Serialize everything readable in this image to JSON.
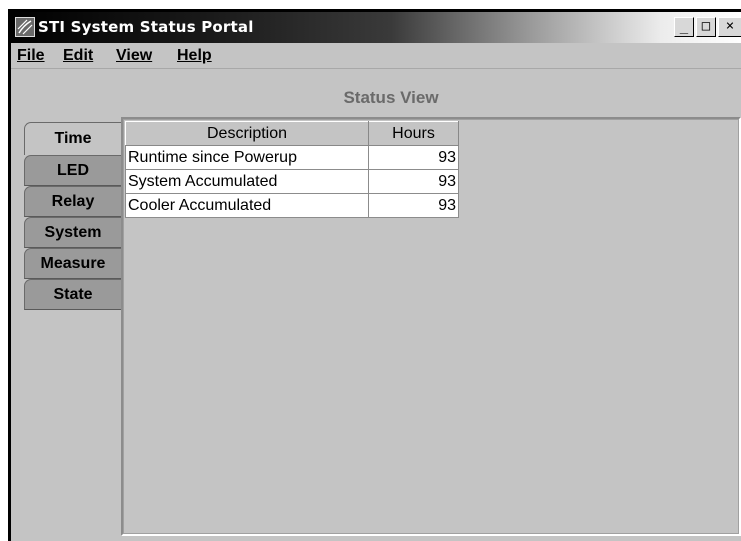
{
  "window": {
    "title": "STI System Status Portal",
    "minimize_glyph": "_",
    "maximize_glyph": "□",
    "close_glyph": "×"
  },
  "menu": [
    {
      "label": "File"
    },
    {
      "label": "Edit"
    },
    {
      "label": "View"
    },
    {
      "label": "Help"
    }
  ],
  "view_title": "Status View",
  "tabs": [
    {
      "label": "Time",
      "active": true
    },
    {
      "label": "LED"
    },
    {
      "label": "Relay"
    },
    {
      "label": "System"
    },
    {
      "label": "Measure"
    },
    {
      "label": "State"
    }
  ],
  "table": {
    "headers": [
      "Description",
      "Hours"
    ],
    "rows": [
      [
        "Runtime since Powerup",
        "93"
      ],
      [
        "System Accumulated",
        "93"
      ],
      [
        "Cooler Accumulated",
        "93"
      ]
    ]
  },
  "colors": {
    "window_bg": "#c4c4c4",
    "inactive_tab": "#9a9a9a",
    "view_title": "#6a6a6a"
  },
  "icons": {
    "app": "sti-app-icon"
  }
}
